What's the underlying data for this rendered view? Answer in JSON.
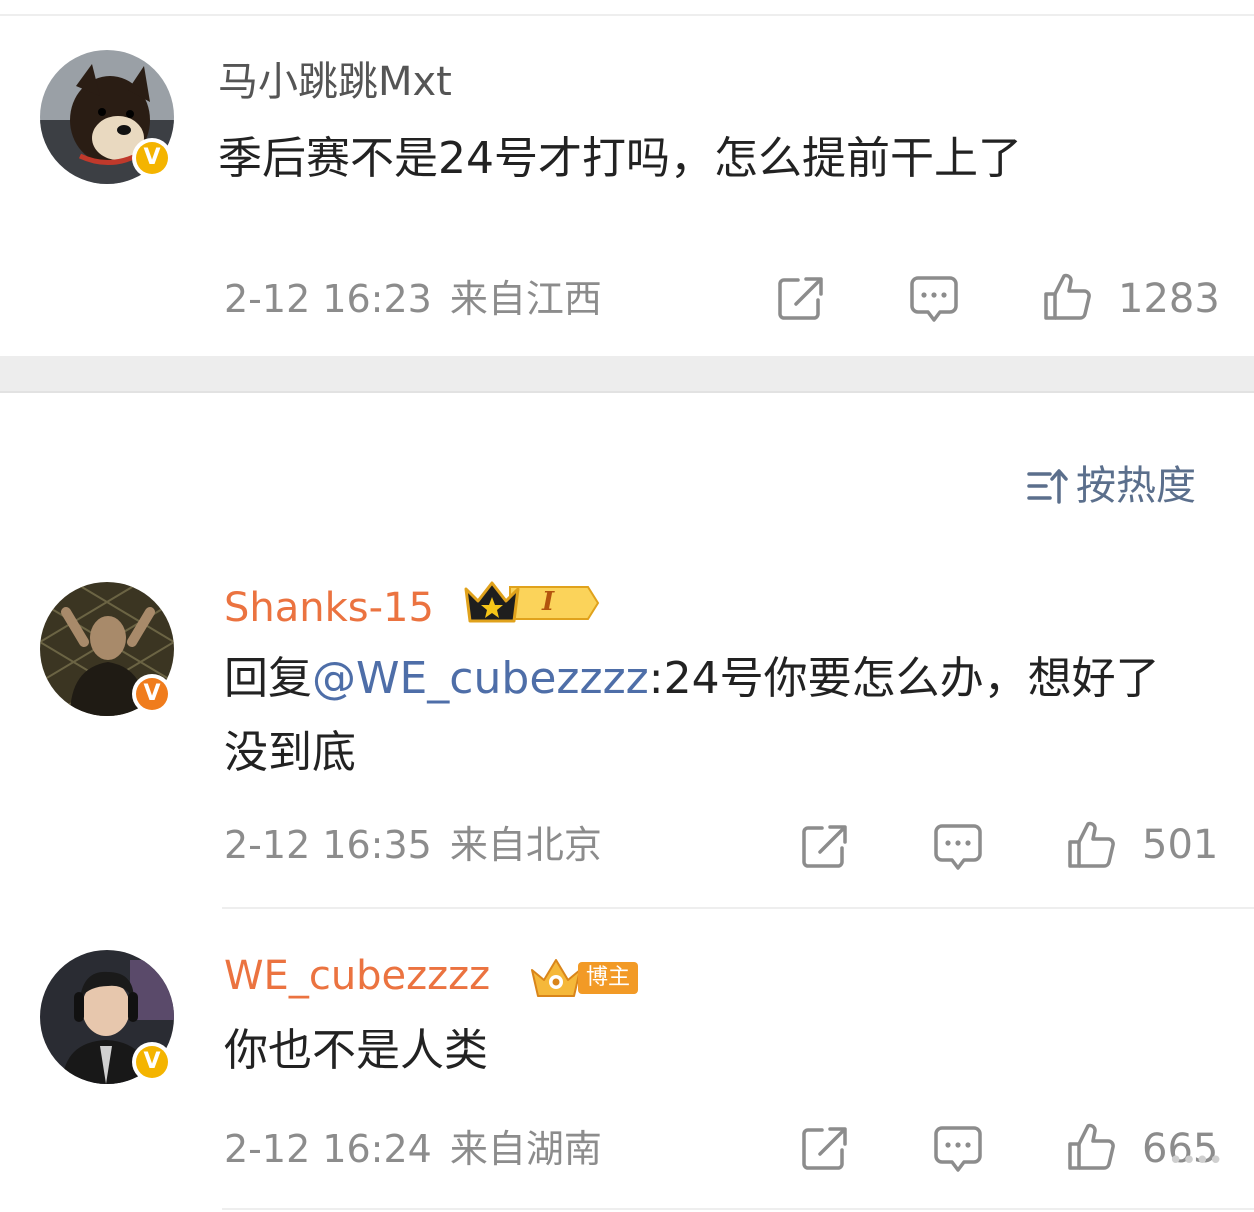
{
  "colors": {
    "mention_blue": "#4e6ea8",
    "name_orange": "#eb7340",
    "meta_gray": "#8c8c8c",
    "badge_gold": "#f4b400",
    "badge_orange": "#f07c1c"
  },
  "icons": {
    "share": "share-icon",
    "comment": "comment-icon",
    "like": "like-icon",
    "sort": "sort-icon"
  },
  "top_comment": {
    "username": "马小跳跳Mxt",
    "text": "季后赛不是24号才打吗，怎么提前干上了",
    "time": "2-12 16:23",
    "location": "来自江西",
    "likes": "1283",
    "verified": "V"
  },
  "sort_label": "按热度",
  "replies": [
    {
      "username": "Shanks-15",
      "reply_prefix": "回复",
      "mention": "@WE_cubezzzz",
      "text": ":24号你要怎么办，想好了没到底",
      "time": "2-12 16:35",
      "location": "来自北京",
      "likes": "501",
      "verified": "V",
      "rank_badge": "I"
    },
    {
      "username": "WE_cubezzzz",
      "text": "你也不是人类",
      "time": "2-12 16:24",
      "location": "来自湖南",
      "likes": "665",
      "verified": "V",
      "role_badge": "博主"
    }
  ]
}
